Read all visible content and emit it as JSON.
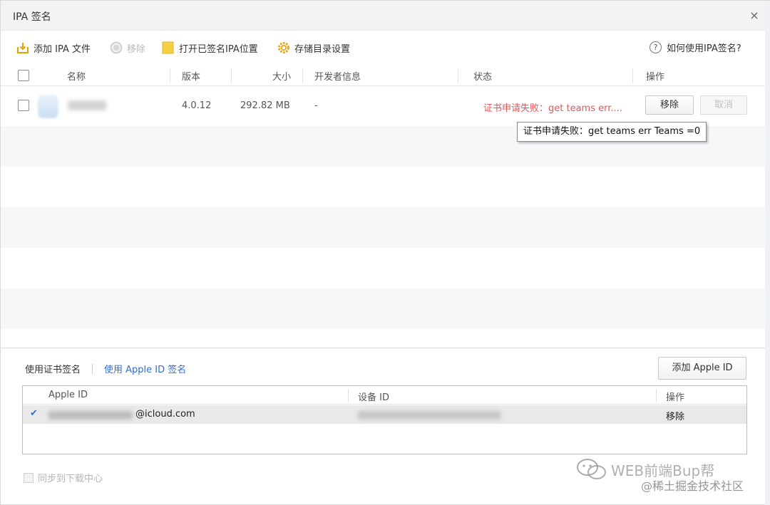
{
  "window": {
    "title": "IPA 签名",
    "close_glyph": "×"
  },
  "toolbar": {
    "add_file": "添加 IPA 文件",
    "remove": "移除",
    "open_signed_location": "打开已签名IPA位置",
    "storage_settings": "存储目录设置",
    "help": "如何使用IPA签名?",
    "help_glyph": "?"
  },
  "table": {
    "columns": [
      "名称",
      "版本",
      "大小",
      "开发者信息",
      "状态",
      "操作"
    ],
    "rows": [
      {
        "version": "4.0.12",
        "size": "292.82 MB",
        "developer": "-",
        "status": "证书申请失败：get teams err....",
        "actions": {
          "remove": "移除",
          "cancel": "取消"
        }
      }
    ],
    "tooltip": "证书申请失败：get teams err Teams =0"
  },
  "signing": {
    "tab_cert": "使用证书签名",
    "tab_appleid": "使用 Apple ID 签名",
    "add_appleid": "添加 Apple ID",
    "columns": {
      "apple_id": "Apple ID",
      "device_id": "设备 ID",
      "action": "操作"
    },
    "rows": [
      {
        "check": "✔",
        "email_suffix": "@icloud.com",
        "action": "移除"
      }
    ],
    "sync_label": "同步到下载中心"
  },
  "watermark": {
    "line1": "WEB前端Bup帮",
    "line2": "@稀土掘金技术社区"
  },
  "colors": {
    "error": "#e0565b",
    "link": "#2f6fd1",
    "accent_icon": "#f5b800"
  }
}
